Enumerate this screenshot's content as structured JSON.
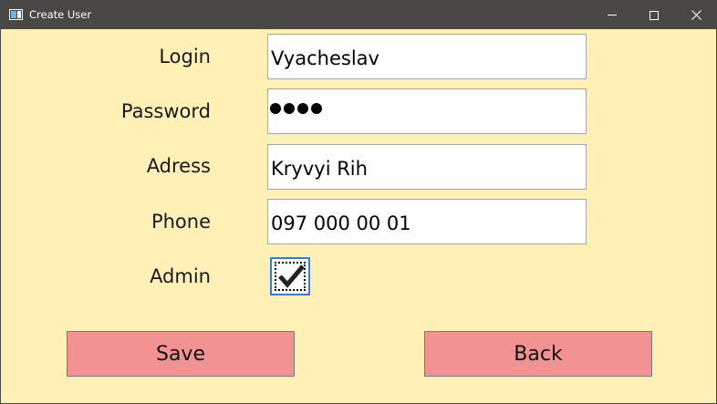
{
  "window": {
    "title": "Create User",
    "background": "#fff0b6",
    "titlebar_color": "#4a4846",
    "controls": [
      "minimize-icon",
      "maximize-icon",
      "close-icon"
    ]
  },
  "form": {
    "login": {
      "label": "Login",
      "value": "Vyacheslav"
    },
    "password": {
      "label": "Password",
      "masked_length": 4
    },
    "address": {
      "label": "Adress",
      "value": "Kryvyi Rih"
    },
    "phone": {
      "label": "Phone",
      "value": "097 000 00 01"
    },
    "admin": {
      "label": "Admin",
      "checked": true
    }
  },
  "buttons": {
    "save_label": "Save",
    "back_label": "Back",
    "color": "#f29292"
  }
}
